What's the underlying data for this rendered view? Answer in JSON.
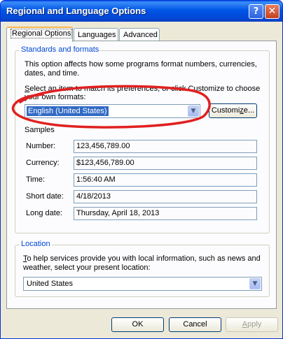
{
  "window": {
    "title": "Regional and Language Options"
  },
  "titlebar_buttons": {
    "help": "?",
    "close": "✕"
  },
  "tabs": [
    {
      "label": "Regional Options",
      "active": true
    },
    {
      "label": "Languages",
      "active": false
    },
    {
      "label": "Advanced",
      "active": false
    }
  ],
  "standards": {
    "legend": "Standards and formats",
    "desc1": "This option affects how some programs format numbers, currencies,",
    "desc2": "dates, and time.",
    "select_prefix": "S",
    "select1": "elect an item to match its preferences, or click Customize to choose",
    "select2": "your own formats:",
    "selected_format": "English (United States)",
    "customize_prefix": "Customi",
    "customize_u": "z",
    "customize_suffix": "e...",
    "samples_label": "Samples",
    "samples": [
      {
        "label": "Number:",
        "value": "123,456,789.00"
      },
      {
        "label": "Currency:",
        "value": "$123,456,789.00"
      },
      {
        "label": "Time:",
        "value": "1:56:40 AM"
      },
      {
        "label": "Short date:",
        "value": "4/18/2013"
      },
      {
        "label": "Long date:",
        "value": "Thursday, April 18, 2013"
      }
    ]
  },
  "location": {
    "legend": "Location",
    "desc_prefix": "T",
    "desc1": "o help services provide you with local information, such as news and",
    "desc2": "weather, select your present location:",
    "selected": "United States"
  },
  "footer": {
    "ok": "OK",
    "cancel": "Cancel",
    "apply_prefix": "A",
    "apply_suffix": "pply"
  },
  "colors": {
    "accent": "#0046d5",
    "annotation": "#e02020",
    "selection": "#316ac5"
  },
  "icons": {
    "dropdown": "chevron-down-icon",
    "help": "help-icon",
    "close": "close-icon"
  }
}
